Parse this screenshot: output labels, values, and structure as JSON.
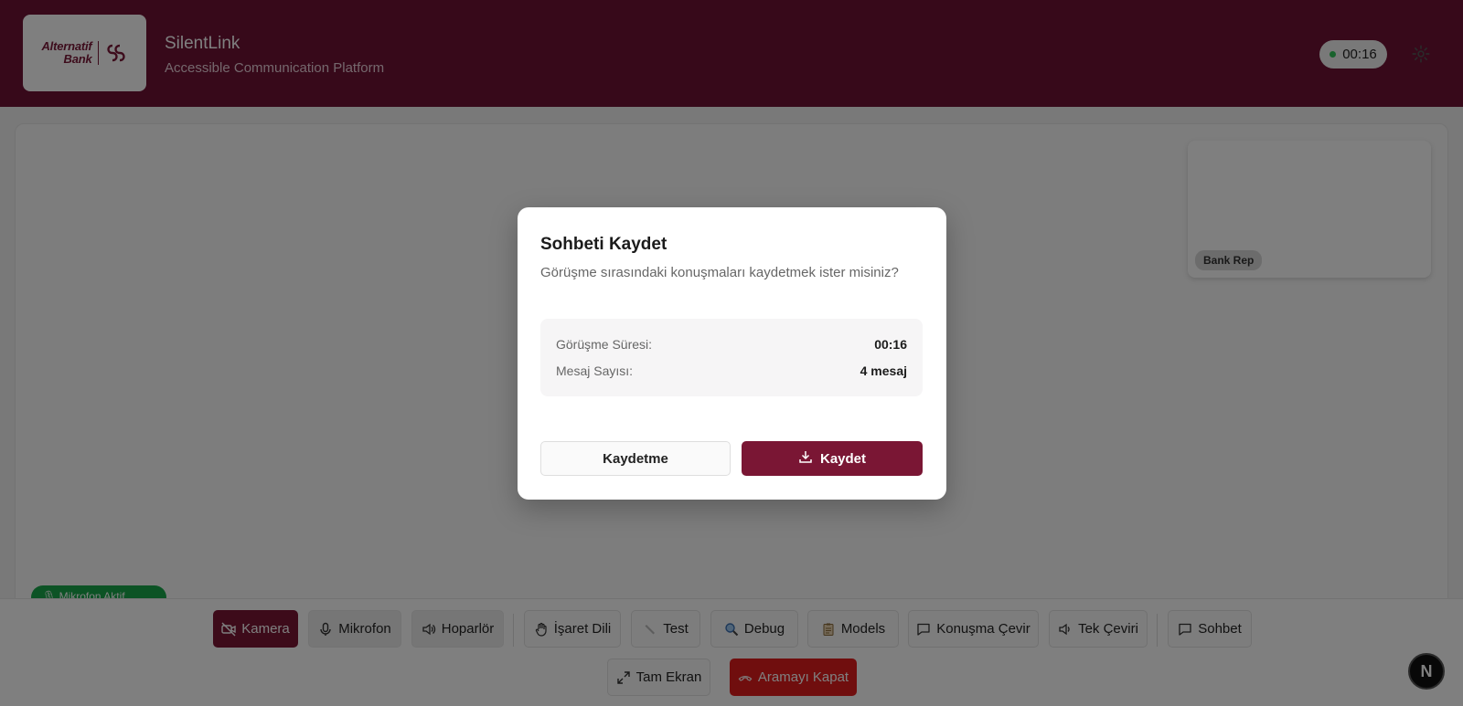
{
  "header": {
    "logo_line1": "Alternatif",
    "logo_line2": "Bank",
    "app_title": "SilentLink",
    "app_subtitle": "Accessible Communication Platform",
    "call_timer": "00:16",
    "status_color": "#33c45a",
    "background_color": "#6e1235"
  },
  "video": {
    "rep_label": "Bank Rep",
    "status_pill": "🎙 Mikrofon Aktif"
  },
  "controls": {
    "row1": [
      {
        "label": "Kamera",
        "icon": "camera-off-icon"
      },
      {
        "label": "Mikrofon",
        "icon": "microphone-icon"
      },
      {
        "label": "Hoparlör",
        "icon": "speaker-icon"
      },
      {
        "label": "İşaret Dili",
        "icon": "hand-icon"
      },
      {
        "label": "Test",
        "icon": "test-tube-icon"
      },
      {
        "label": "Debug",
        "icon": "magnifier-icon"
      },
      {
        "label": "Models",
        "icon": "clipboard-icon"
      },
      {
        "label": "Konuşma Çevir",
        "icon": "chat-bubble-icon"
      },
      {
        "label": "Tek Çeviri",
        "icon": "speaker-icon"
      },
      {
        "label": "Sohbet",
        "icon": "chat-bubble-icon"
      }
    ],
    "row2": [
      {
        "label": "Tam Ekran",
        "icon": "expand-icon"
      },
      {
        "label": "Aramayı Kapat",
        "icon": "hang-up-icon"
      }
    ]
  },
  "modal": {
    "title": "Sohbeti Kaydet",
    "subtitle": "Görüşme sırasındaki konuşmaları kaydetmek ister misiniz?",
    "duration_label": "Görüşme Süresi:",
    "duration_value": "00:16",
    "message_count_label": "Mesaj Sayısı:",
    "message_count_value": "4 mesaj",
    "cancel_label": "Kaydetme",
    "save_label": "Kaydet"
  },
  "colors": {
    "accent": "#7a1634",
    "danger": "#e01c1c",
    "success": "#19a64a"
  },
  "framework_badge": "N"
}
